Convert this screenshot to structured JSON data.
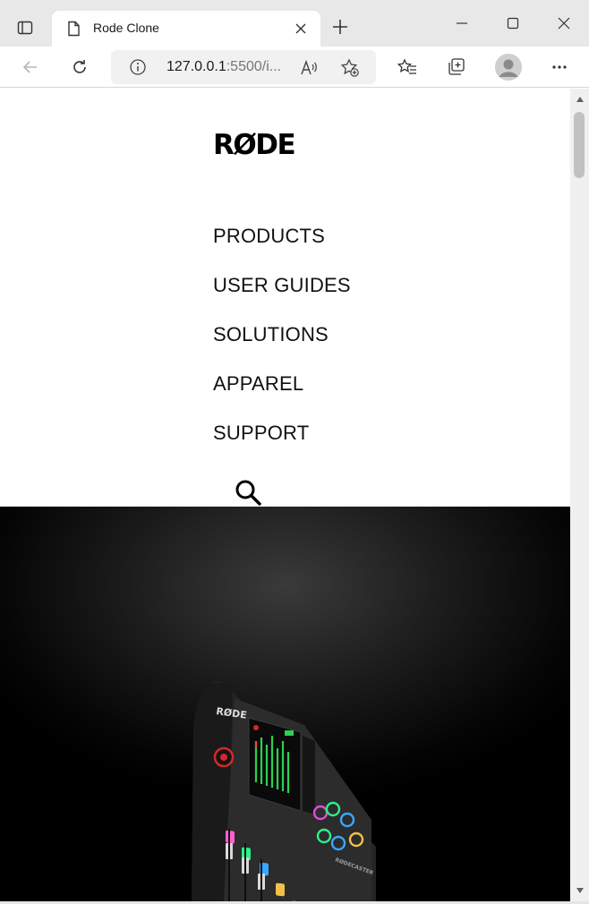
{
  "browser": {
    "tab_title": "Rode Clone",
    "address": {
      "host": "127.0.0.1",
      "rest": ":5500/i..."
    }
  },
  "site": {
    "logo_text": "RØDE",
    "nav": [
      "PRODUCTS",
      "USER GUIDES",
      "SOLUTIONS",
      "APPAREL",
      "SUPPORT"
    ],
    "device_brand": "RØDE",
    "device_badge": "RØDECASTER"
  },
  "icons": {
    "tab_actions": "tab-actions-icon",
    "favicon": "page-icon",
    "close": "close-icon",
    "new_tab": "plus-icon",
    "minimize": "minimize-icon",
    "maximize": "maximize-icon",
    "window_close": "window-close-icon",
    "back": "back-arrow-icon",
    "refresh": "refresh-icon",
    "info": "info-icon",
    "read_aloud": "read-aloud-icon",
    "add_favorite": "add-favorite-icon",
    "favorites": "favorites-icon",
    "collections": "collections-icon",
    "profile": "avatar-icon",
    "more": "more-icon",
    "search": "search-icon"
  },
  "colors": {
    "hero_bg": "#000000",
    "accent_red": "#d62828",
    "text": "#111111"
  }
}
